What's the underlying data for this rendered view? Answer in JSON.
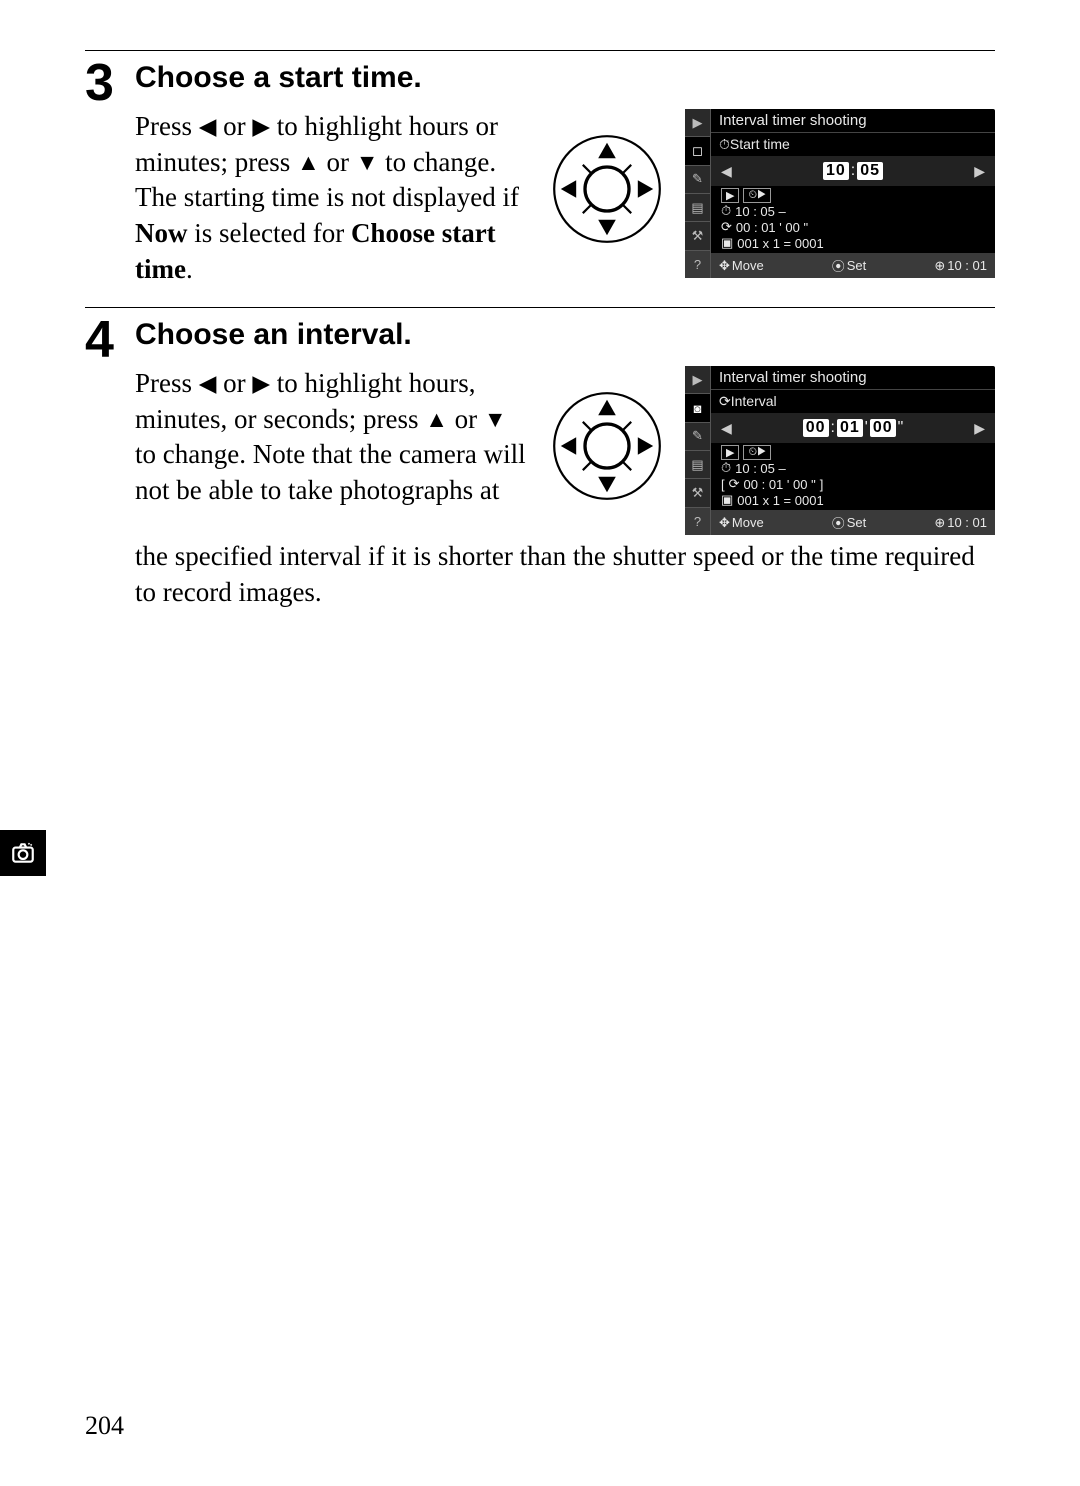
{
  "page_number": "204",
  "steps": [
    {
      "number": "3",
      "title": "Choose a start time.",
      "text_pre": "Press ",
      "text_mid1": " or ",
      "text_mid2": " to highlight hours or minutes; press ",
      "text_mid3": " or ",
      "text_mid4": " to change.  The starting time is not displayed if ",
      "bold1": "Now",
      "text_mid5": " is selected for ",
      "bold2": "Choose start time",
      "text_end": ".",
      "continuation": ""
    },
    {
      "number": "4",
      "title": "Choose an interval.",
      "text_pre": "Press ",
      "text_mid1": " or ",
      "text_mid2": " to highlight hours, minutes, or seconds; press ",
      "text_mid3": " or ",
      "text_mid4": " to change.  Note that the camera will not be able to take photographs at",
      "bold1": "",
      "text_mid5": "",
      "bold2": "",
      "text_end": "",
      "continuation": "the specified interval if it is shorter than the shutter speed or the time required to record images."
    }
  ],
  "lcd1": {
    "title": "Interval timer shooting",
    "sub_icon": "⏱",
    "sub": "Start time",
    "value_a": "10",
    "value_sep": ":",
    "value_b": "05",
    "info_play": "▶",
    "info_clock": "⏲▶",
    "info_line1_pre": "⏱",
    "info_line1": "10 : 05  –",
    "info_line2_pre": "⟳",
    "info_line2": "00 : 01 ' 00 \"",
    "info_line3_pre": "▣",
    "info_line3": "001 x 1 = 0001",
    "foot_move": "Move",
    "foot_set": "Set",
    "foot_clock": "10 : 01"
  },
  "lcd2": {
    "title": "Interval timer shooting",
    "sub_icon": "⟳",
    "sub": "Interval",
    "value_a": "00",
    "value_sep1": ":",
    "value_b": "01",
    "value_sep2": "'",
    "value_c": "00",
    "value_sep3": "\"",
    "info_play": "▶",
    "info_clock": "⏲▶",
    "info_line1_pre": "⏱",
    "info_line1": "10 : 05  –",
    "info_line2_pre": "⟳",
    "info_line2": "00 : 01 ' 00 \"",
    "info_line3_pre": "▣",
    "info_line3": "001 x 1 = 0001",
    "foot_move": "Move",
    "foot_set": "Set",
    "foot_clock": "10 : 01"
  },
  "side_icons": [
    "▶",
    "◻",
    "✎",
    "▤",
    "⚒",
    "?"
  ],
  "tab_icon": "📷"
}
